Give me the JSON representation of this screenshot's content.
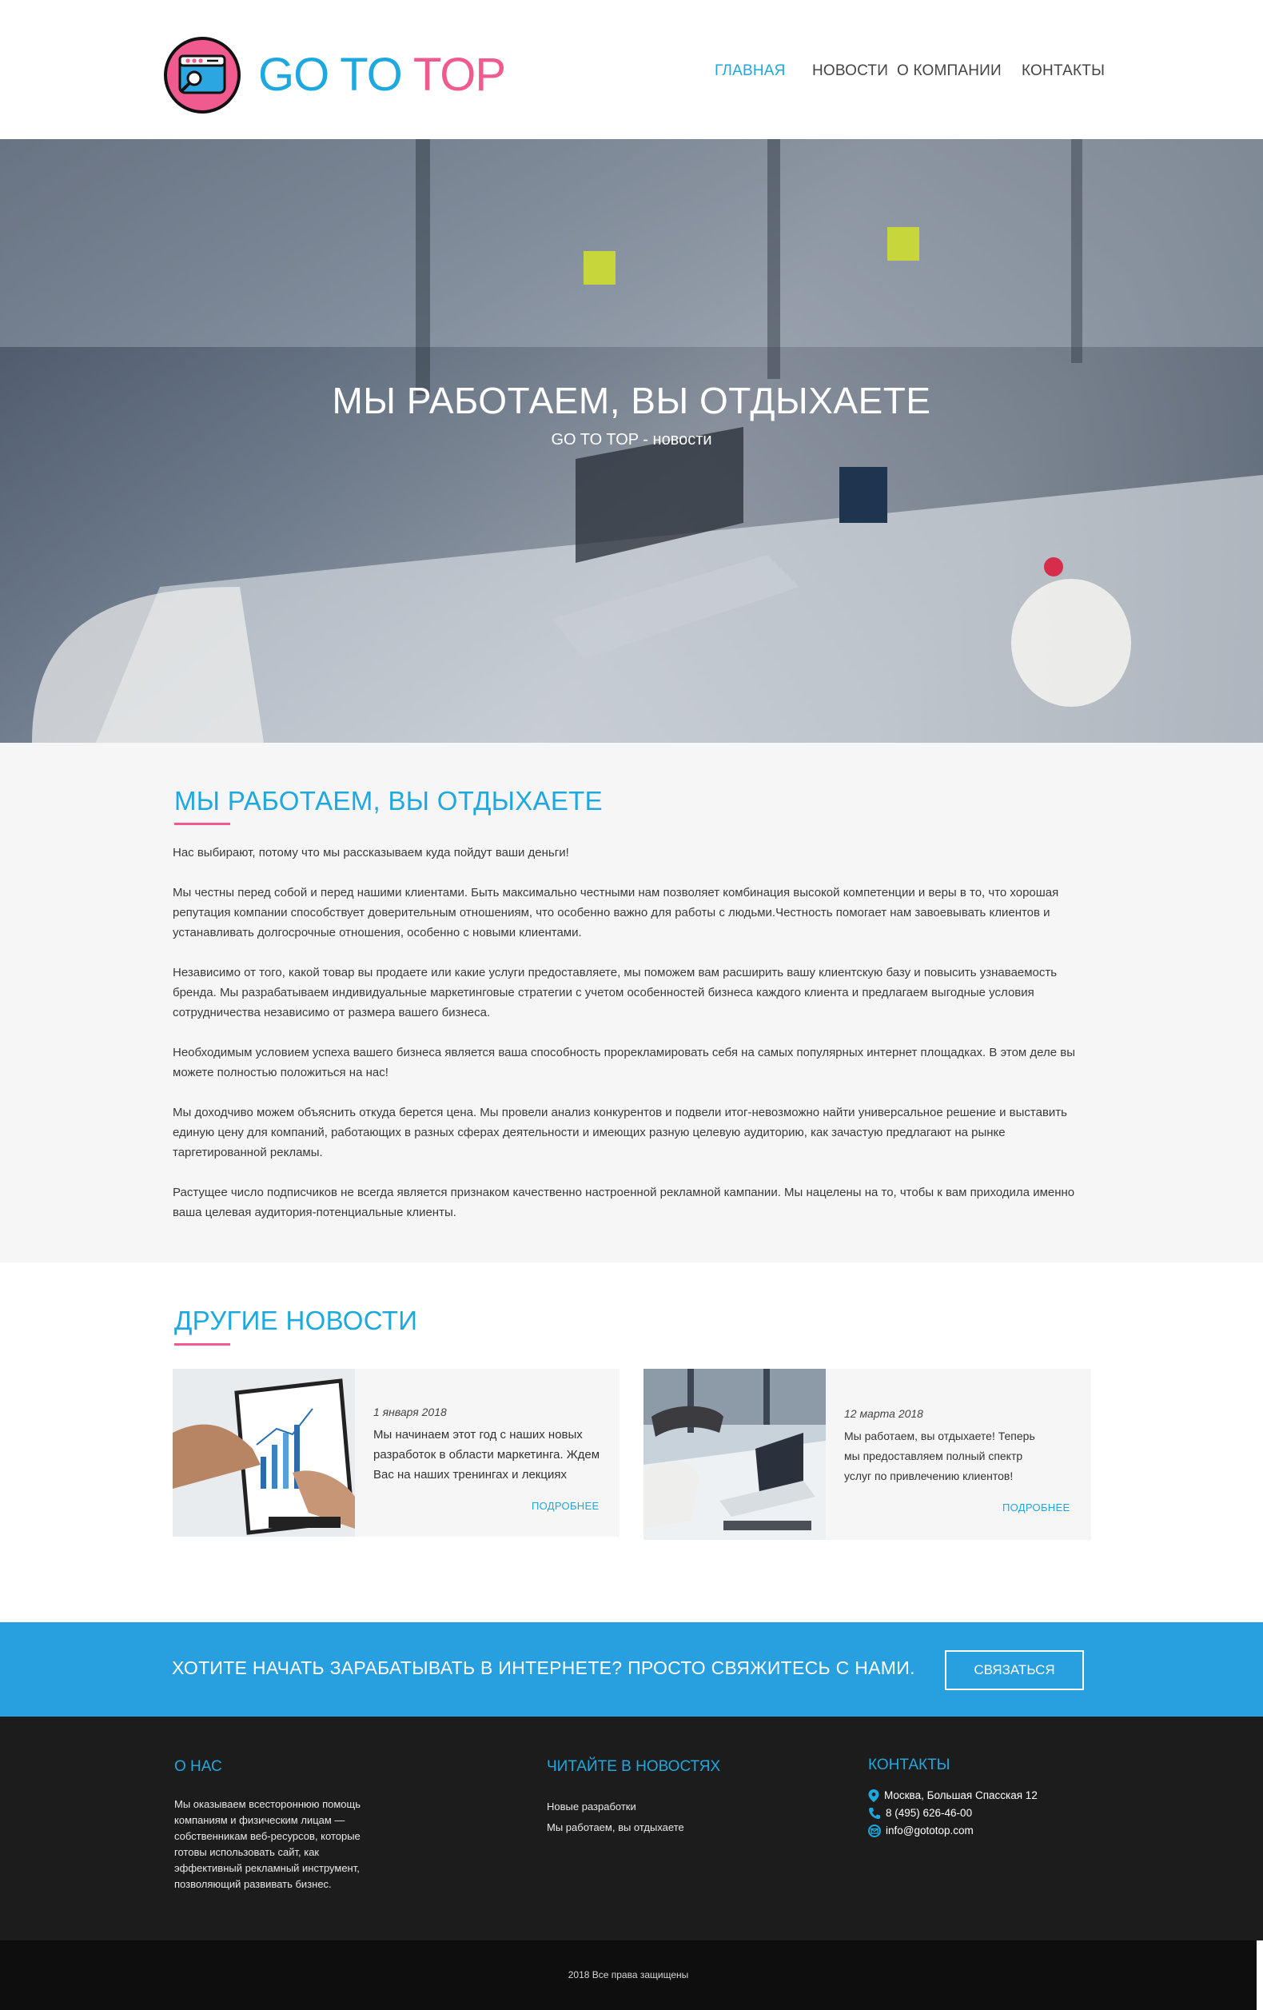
{
  "brand": {
    "goto": "GO TO",
    "top": "TOP"
  },
  "nav": {
    "items": [
      {
        "label": "Главная",
        "active": true
      },
      {
        "label": "Новости",
        "active": false
      },
      {
        "label": "О компании",
        "active": false
      },
      {
        "label": "Контакты",
        "active": false
      }
    ]
  },
  "hero": {
    "title": "МЫ РАБОТАЕМ, ВЫ ОТДЫХАЕТЕ",
    "subtitle": "GO TO TOP - новости"
  },
  "article": {
    "title": "Мы работаем, вы отдыхаете",
    "paragraphs": [
      "Нас выбирают, потому что мы рассказываем куда пойдут ваши деньги!",
      "Мы честны перед собой и перед нашими клиентами. Быть максимально честными нам позволяет комбинация высокой компетенции и веры в то, что хорошая репутация компании способствует доверительным отношениям, что особенно важно для работы с людьми.Честность помогает нам завоевывать клиентов и устанавливать долгосрочные отношения, особенно с новыми клиентами.",
      "Независимо от того, какой товар вы продаете или какие услуги предоставляете, мы поможем вам расширить вашу клиентскую базу и повысить узнаваемость бренда. Мы разрабатываем индивидуальные маркетинговые стратегии с учетом особенностей бизнеса каждого клиента и предлагаем выгодные условия сотрудничества независимо от размера вашего бизнеса.",
      "Необходимым условием успеха вашего бизнеса является ваша способность прорекламировать себя на самых популярных интернет площадках. В этом деле вы можете полностью положиться на нас!",
      "Мы доходчиво можем объяснить откуда берется цена. Мы провели анализ конкурентов и подвели итог-невозможно найти универсальное решение и выставить единую цену для компаний, работающих в разных сферах деятельности и имеющих разную целевую аудиторию, как зачастую предлагают на рынке таргетированной рекламы.",
      "Растущее число подписчиков не всегда является признаком качественно настроенной рекламной кампании. Мы нацелены на то, чтобы к вам приходила именно ваша целевая аудитория-потенциальные клиенты."
    ]
  },
  "news": {
    "title": "Другие новости",
    "items": [
      {
        "date": "1 января 2018",
        "text": "Мы начинаем этот год с наших новых разработок в области маркетинга. Ждем Вас на наших тренингах и лекциях",
        "more": "Подробнее"
      },
      {
        "date": "12 марта 2018",
        "text": "Мы работаем, вы отдыхаете! Теперь мы предоставляем полный спектр услуг по привлечению клиентов!",
        "more": "Подробнее"
      }
    ]
  },
  "cta": {
    "text": "Хотите начать зарабатывать в интернете? Просто свяжитесь с нами.",
    "button": "Связаться"
  },
  "footer": {
    "about": {
      "title": "О нас",
      "text": "Мы оказываем всестороннюю помощь компаниям и физическим лицам — собственникам веб-ресурсов, которые готовы использовать сайт, как эффективный рекламный инструмент, позволяющий развивать бизнес."
    },
    "news": {
      "title": "Читайте в новостях",
      "items": [
        "Новые разработки",
        "Мы работаем, вы отдыхаете"
      ]
    },
    "contacts": {
      "title": "Контакты",
      "address": "Москва, Большая Спасская 12",
      "phone": "8 (495) 626-46-00",
      "email": "info@gototop.com"
    },
    "copyright": "2018 Все права защищены"
  },
  "colors": {
    "accent": "#1ea8e0",
    "pink": "#f05a8e",
    "cta": "#289fdf",
    "footer": "#1c1c1c"
  }
}
